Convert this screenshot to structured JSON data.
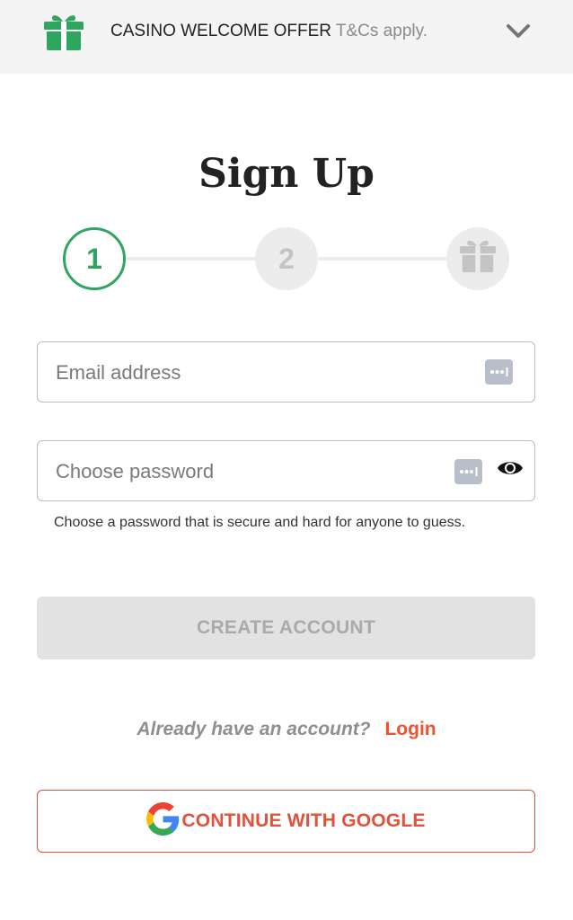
{
  "offer": {
    "title": "CASINO WELCOME OFFER",
    "terms": "T&Cs apply.",
    "icon": "gift-icon",
    "expand_icon": "chevron-down-icon"
  },
  "title": "Sign Up",
  "stepper": {
    "steps": [
      "1",
      "2",
      ""
    ],
    "active_step": 1,
    "final_step_icon": "gift-icon"
  },
  "form": {
    "email_placeholder": "Email address",
    "email_value": "",
    "password_placeholder": "Choose password",
    "password_value": "",
    "password_hint": "Choose a password that is secure and hard for anyone to guess.",
    "autofill_icon": "password-manager-key-icon",
    "reveal_icon": "eye-icon"
  },
  "create_account_label": "CREATE ACCOUNT",
  "login": {
    "question": "Already have an account?",
    "link": "Login"
  },
  "google": {
    "label": "CONTINUE WITH GOOGLE",
    "icon": "google-logo-icon"
  },
  "colors": {
    "brand_green": "#2ea660",
    "accent_orange": "#f0522f",
    "google_red": "#e0523a",
    "disabled_gray": "#e2e2e2"
  }
}
